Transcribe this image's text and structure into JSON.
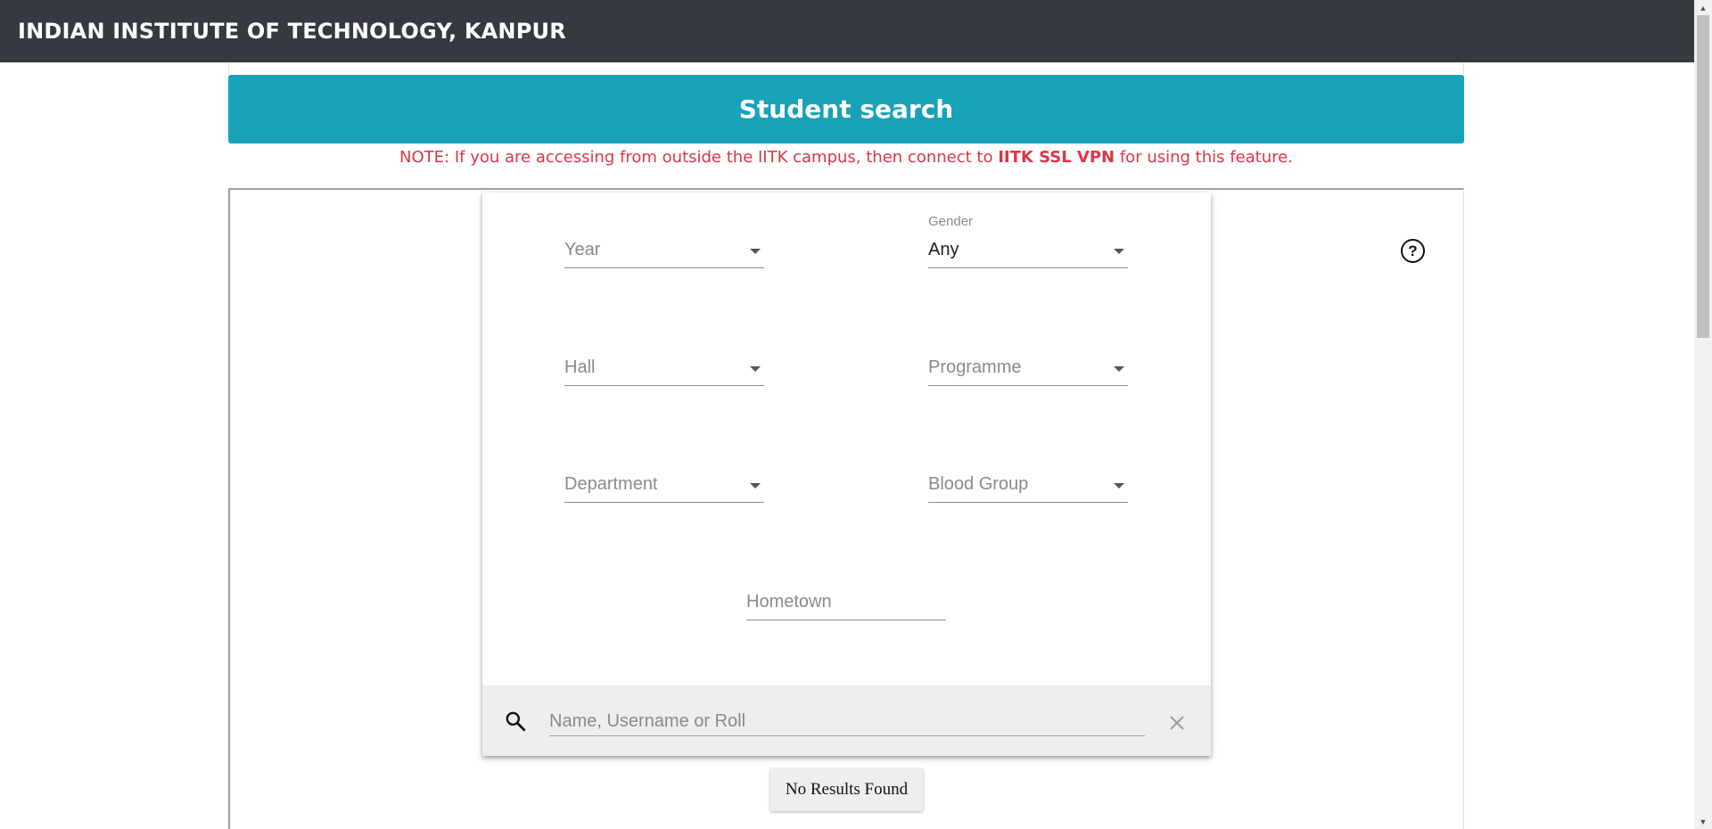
{
  "header": {
    "title": "INDIAN INSTITUTE OF TECHNOLOGY, KANPUR"
  },
  "banner": {
    "title": "Student search"
  },
  "note": {
    "prefix": "NOTE: If you are accessing from outside the IITK campus, then connect to ",
    "link": "IITK SSL VPN",
    "suffix": " for using this feature."
  },
  "filters": {
    "year": {
      "placeholder": "Year"
    },
    "gender": {
      "label": "Gender",
      "value": "Any"
    },
    "hall": {
      "placeholder": "Hall"
    },
    "programme": {
      "placeholder": "Programme"
    },
    "department": {
      "placeholder": "Department"
    },
    "blood_group": {
      "placeholder": "Blood Group"
    },
    "hometown": {
      "placeholder": "Hometown"
    }
  },
  "search": {
    "placeholder": "Name, Username or Roll"
  },
  "results": {
    "label": "No Results Found"
  },
  "icons": {
    "help": "help-circle-icon",
    "search": "search-icon",
    "close": "close-icon"
  },
  "colors": {
    "header_bg": "#343a40",
    "banner_bg": "#17a2b8",
    "note_text": "#dc3545"
  }
}
